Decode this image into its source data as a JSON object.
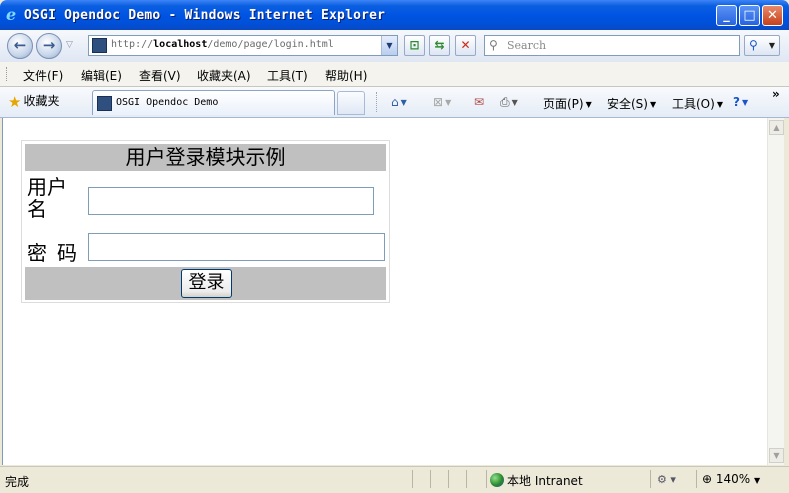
{
  "window": {
    "title": "OSGI Opendoc Demo - Windows Internet Explorer",
    "buttons": [
      "minimize",
      "maximize",
      "close"
    ]
  },
  "address_bar": {
    "url_prefix": "http://",
    "url_host": "localhost",
    "url_path": "/demo/page/login.html",
    "search_placeholder": "Search"
  },
  "menu": {
    "items": [
      "文件(F)",
      "编辑(E)",
      "查看(V)",
      "收藏夹(A)",
      "工具(T)",
      "帮助(H)"
    ]
  },
  "favorites_bar": {
    "favorites_label": "收藏夹",
    "tab_title": "OSGI Opendoc Demo",
    "commands": [
      "页面(P)",
      "安全(S)",
      "工具(O)"
    ],
    "more": "»"
  },
  "page": {
    "header": "用户登录模块示例",
    "username_label": "用户名",
    "password_label": "密码",
    "username_value": "",
    "password_value": "",
    "login_button": "登录"
  },
  "status_bar": {
    "status": "完成",
    "zone_label": "本地 Intranet",
    "zoom": "140%"
  },
  "icons": {
    "back": "back-arrow-icon",
    "forward": "forward-arrow-icon",
    "refresh": "refresh-icon",
    "stop": "stop-icon",
    "home": "home-icon",
    "feeds": "feeds-icon",
    "mail": "mail-icon",
    "print": "print-icon",
    "help": "help-icon"
  },
  "colors": {
    "titlebar": "#0054e3",
    "login_header_bg": "#c0c0c0"
  }
}
